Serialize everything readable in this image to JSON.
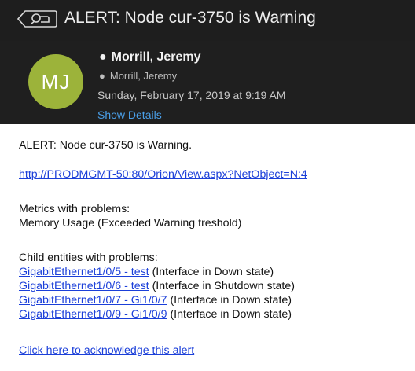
{
  "title_bar": {
    "subject": "ALERT: Node cur-3750 is Warning",
    "tag_icon": "tag-icon"
  },
  "message_header": {
    "avatar_initials": "MJ",
    "avatar_color": "#9cb33a",
    "from": "Morrill, Jeremy",
    "to": "Morrill, Jeremy",
    "date": "Sunday, February 17, 2019 at 9:19 AM",
    "show_details": "Show Details"
  },
  "message_body": {
    "heading": "ALERT: Node cur-3750 is Warning.",
    "node_link": "http://PRODMGMT-50:80/Orion/View.aspx?NetObject=N:4",
    "metrics_title": "Metrics with problems:",
    "metrics_item": "Memory Usage (Exceeded Warning treshold)",
    "children_title": "Child entities with problems:",
    "children": [
      {
        "link": "GigabitEthernet1/0/5 - test",
        "status": "(Interface in Down state)"
      },
      {
        "link": "GigabitEthernet1/0/6 - test",
        "status": "(Interface in Shutdown state)"
      },
      {
        "link": "GigabitEthernet1/0/7 - Gi1/0/7",
        "status": "(Interface in Down state)"
      },
      {
        "link": "GigabitEthernet1/0/9 - Gi1/0/9",
        "status": "(Interface in Down state)"
      }
    ],
    "ack_link": "Click here to acknowledge this alert"
  },
  "colors": {
    "background": "#1e1e1e",
    "link": "#1b3fd9",
    "show_details": "#4a9fe8"
  }
}
